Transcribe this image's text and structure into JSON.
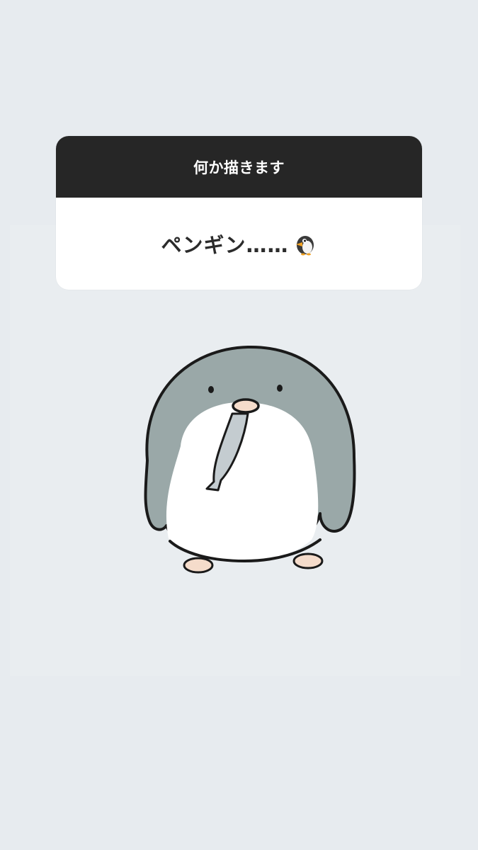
{
  "question_card": {
    "question": "何か描きます",
    "answer": "ペンギン……",
    "answer_emoji": "penguin-icon"
  },
  "illustration": {
    "subject": "penguin-holding-fish",
    "colors": {
      "body_gray": "#9aa8a8",
      "belly_white": "#ffffff",
      "beak_feet": "#f5dccb",
      "fish": "#c4ccd0",
      "outline": "#1a1a1a"
    }
  },
  "colors": {
    "background": "#e7ebef",
    "card_header": "#262626",
    "card_body": "#ffffff"
  }
}
